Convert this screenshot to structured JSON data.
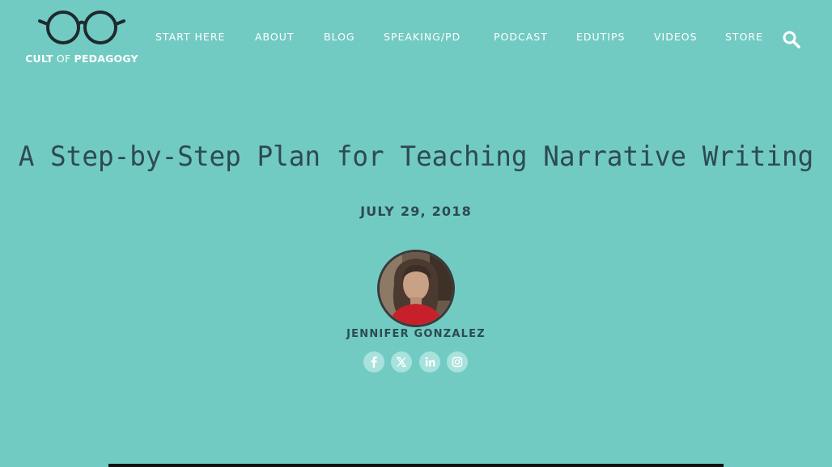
{
  "site": {
    "logo_text_bold": "CULT",
    "logo_text_thin": " OF ",
    "logo_text_bold2": "PEDAGOGY",
    "logo_icon": "glasses-icon"
  },
  "nav": {
    "items": [
      {
        "label": "START HERE"
      },
      {
        "label": "ABOUT"
      },
      {
        "label": "BLOG"
      },
      {
        "label": "SPEAKING/PD"
      },
      {
        "label": "PODCAST"
      },
      {
        "label": "EDUTIPS"
      },
      {
        "label": "VIDEOS"
      },
      {
        "label": "STORE"
      }
    ],
    "search_icon": "search-icon"
  },
  "article": {
    "title": "A Step-by-Step Plan for Teaching Narrative Writing",
    "date": "JULY 29, 2018",
    "author": "JENNIFER GONZALEZ"
  },
  "social": [
    {
      "icon": "facebook-icon"
    },
    {
      "icon": "x-twitter-icon"
    },
    {
      "icon": "linkedin-icon"
    },
    {
      "icon": "instagram-icon"
    }
  ],
  "colors": {
    "background": "#72cbc3",
    "text_dark": "#2d4a52",
    "nav_text": "#ffffff",
    "social_bg": "#a8e2dc",
    "social_icon": "#ffffff"
  }
}
